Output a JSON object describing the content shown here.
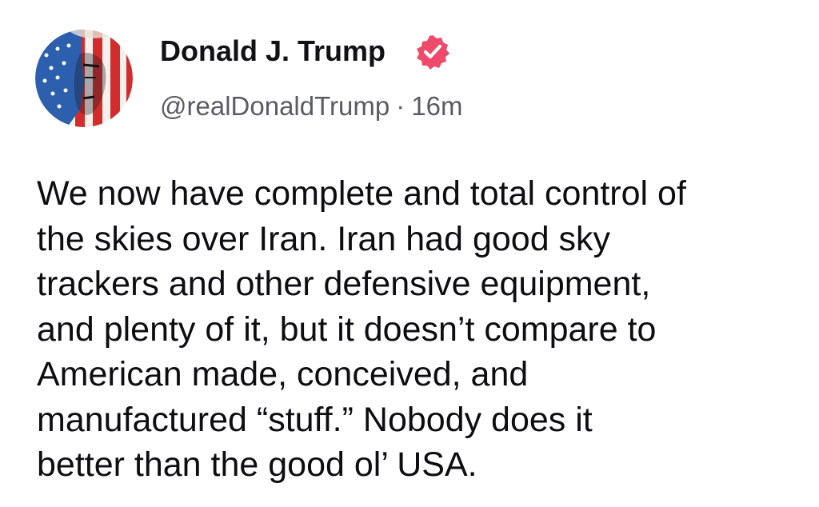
{
  "post": {
    "author": {
      "display_name": "Donald J. Trump",
      "handle": "@realDonaldTrump",
      "verified": true,
      "verified_badge_color": "#ee4b6a",
      "avatar_icon": "flag-portrait-avatar"
    },
    "separator": "·",
    "timestamp": "16m",
    "body_lines": [
      "We now have complete and total control of",
      "the skies over Iran. Iran had good sky",
      "trackers and other defensive equipment,",
      "and plenty of it, but it doesn’t compare to",
      "American made, conceived, and",
      "manufactured “stuff.”  Nobody does it",
      "better than the good ol’ USA."
    ]
  }
}
